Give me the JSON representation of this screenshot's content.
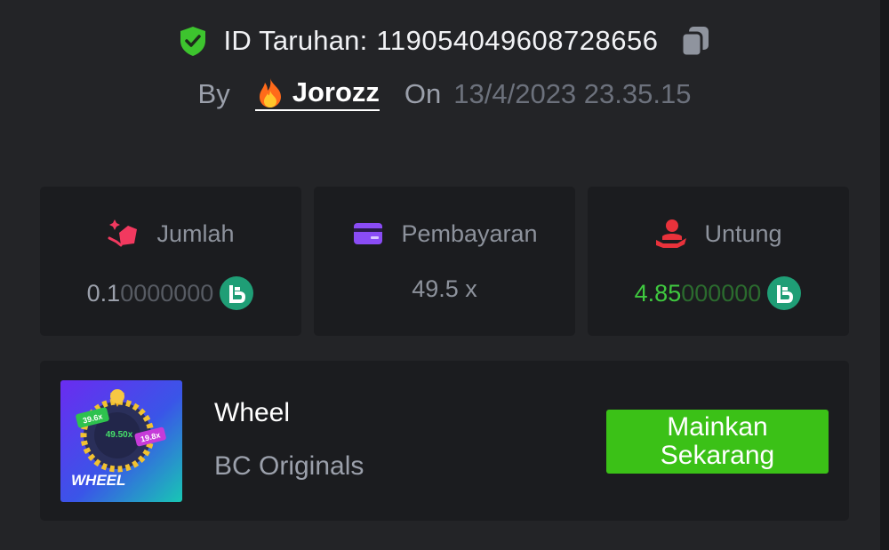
{
  "header": {
    "bet_id_label": "ID Taruhan:",
    "bet_id_value": "119054049608728656",
    "by_label": "By",
    "username": "Jorozz",
    "on_label": "On",
    "datetime": "13/4/2023 23.35.15"
  },
  "stats": {
    "amount": {
      "label": "Jumlah",
      "value_main": "0.1",
      "value_trailing": "0000000",
      "currency_icon": "bc-coin-icon"
    },
    "payout": {
      "label": "Pembayaran",
      "value": "49.5 x"
    },
    "profit": {
      "label": "Untung",
      "value_main": "4.85",
      "value_trailing": "000000",
      "currency_icon": "bc-coin-icon"
    }
  },
  "game": {
    "name": "Wheel",
    "provider": "BC Originals",
    "play_button_label": "Mainkan Sekarang",
    "thumbnail": {
      "title": "WHEEL",
      "badge_left": "39.6x",
      "badge_center": "49.50x",
      "badge_right": "19.8x"
    }
  },
  "colors": {
    "background": "#232427",
    "card": "#1b1c1f",
    "accent_green": "#3bc117",
    "profit_green": "#3fc93f",
    "amount_icon": "#f2395f",
    "payout_icon": "#8a4cf5",
    "profit_icon": "#e8323b",
    "coin": "#1f9e76"
  },
  "icons": {
    "verified": "shield-check-icon",
    "copy": "copy-icon",
    "user_badge": "fire-icon",
    "amount": "coins-hand-icon",
    "payout": "wallet-card-icon",
    "profit": "hand-profit-icon"
  }
}
